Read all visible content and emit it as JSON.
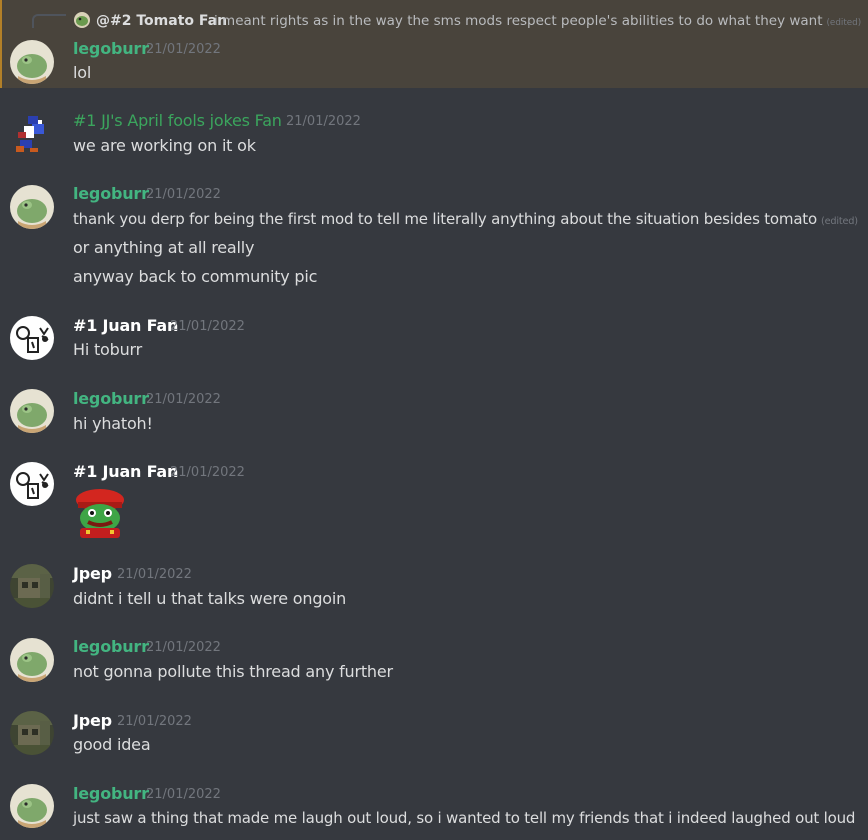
{
  "reply": {
    "author": "@#2 Tomato Fan",
    "text": "i meant rights as in the way the sms mods respect people's abilities to do what they want",
    "edited": "(edited)"
  },
  "messages": [
    {
      "author": "legoburr",
      "timestamp": "21/01/2022",
      "lines": [
        "lol"
      ]
    },
    {
      "author": "#1 JJ's April fools jokes Fan",
      "timestamp": "21/01/2022",
      "lines": [
        "we are working on it ok"
      ]
    },
    {
      "author": "legoburr",
      "timestamp": "21/01/2022",
      "lines": [
        "thank you derp for being the first mod to tell me literally anything about the situation besides tomato",
        "or anything at all really",
        "anyway back to community pic"
      ],
      "edited": "(edited)"
    },
    {
      "author": "#1 Juan Fan",
      "timestamp": "21/01/2022",
      "lines": [
        "Hi toburr"
      ]
    },
    {
      "author": "legoburr",
      "timestamp": "21/01/2022",
      "lines": [
        "hi yhatoh!"
      ]
    },
    {
      "author": "#1 Juan Fan",
      "timestamp": "21/01/2022",
      "lines": [],
      "emoji": "mario-frog-emoji"
    },
    {
      "author": "Jpep",
      "timestamp": "21/01/2022",
      "lines": [
        "didnt i tell u that talks were ongoin"
      ]
    },
    {
      "author": "legoburr",
      "timestamp": "21/01/2022",
      "lines": [
        "not gonna pollute this thread any further"
      ]
    },
    {
      "author": "Jpep",
      "timestamp": "21/01/2022",
      "lines": [
        "good idea"
      ]
    },
    {
      "author": "legoburr",
      "timestamp": "21/01/2022",
      "lines": [
        "just saw a thing that made me laugh out loud, so i wanted to tell my friends that i indeed laughed out loud"
      ]
    }
  ],
  "colors": {
    "background": "#36393f",
    "highlight": "#49443c",
    "role_green": "#43b581",
    "timestamp": "#72767d",
    "text": "#dcddde"
  }
}
